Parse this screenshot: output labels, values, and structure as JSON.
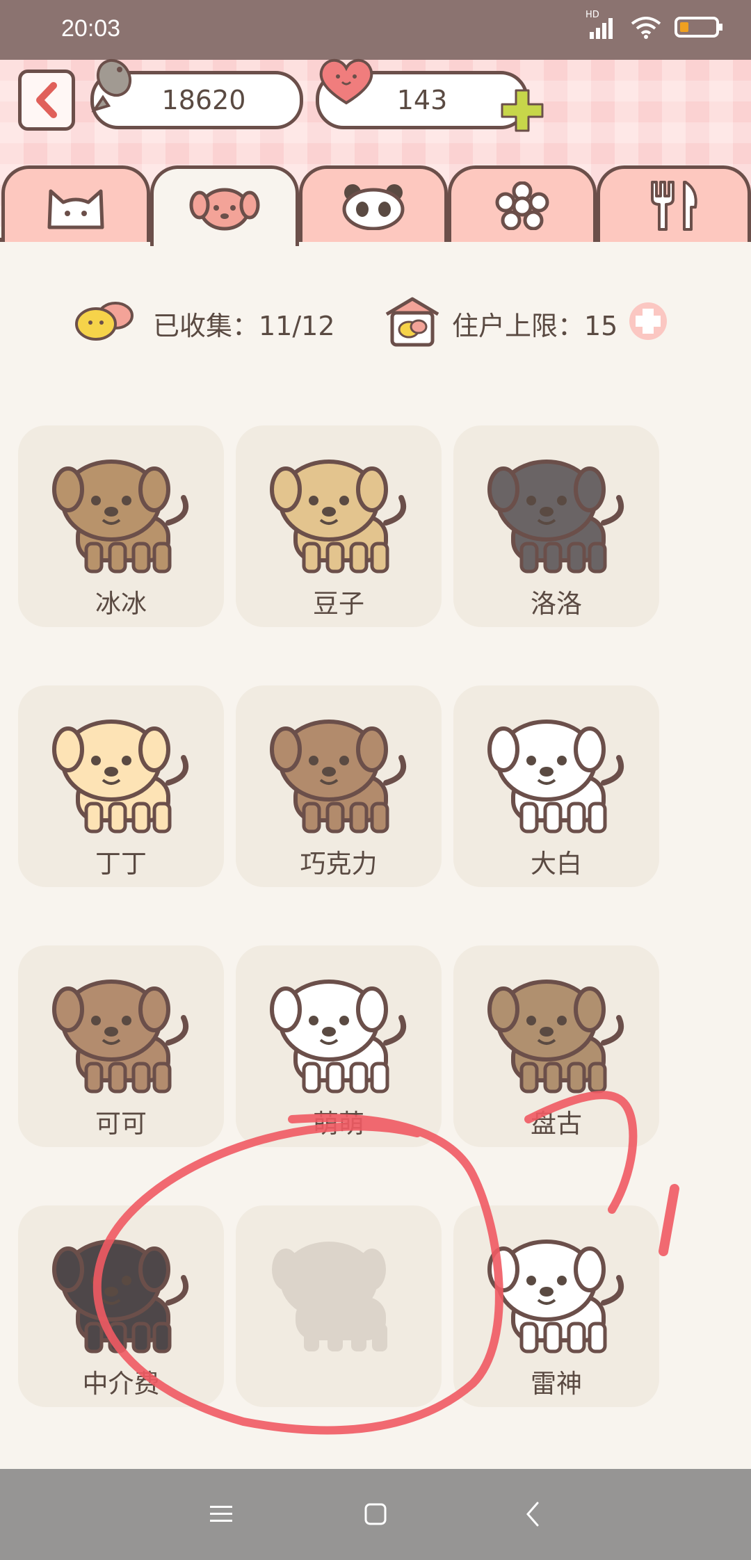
{
  "status": {
    "time": "20:03",
    "network": "HD"
  },
  "header": {
    "fish_count": "18620",
    "heart_count": "143"
  },
  "tabs": [
    {
      "name": "cat",
      "active": false
    },
    {
      "name": "dog",
      "active": true
    },
    {
      "name": "panda",
      "active": false
    },
    {
      "name": "flower",
      "active": false
    },
    {
      "name": "utensils",
      "active": false
    }
  ],
  "stats": {
    "collected_label": "已收集：11/12",
    "capacity_label": "住户上限：15"
  },
  "pets": [
    {
      "name": "冰冰",
      "color": "#b8936b"
    },
    {
      "name": "豆子",
      "color": "#e3c48e"
    },
    {
      "name": "洛洛",
      "color": "#6a6465"
    },
    {
      "name": "丁丁",
      "color": "#fde3b5"
    },
    {
      "name": "巧克力",
      "color": "#b28b6c"
    },
    {
      "name": "大白",
      "color": "#ffffff"
    },
    {
      "name": "可可",
      "color": "#b38c6e"
    },
    {
      "name": "萌萌",
      "color": "#ffffff"
    },
    {
      "name": "盘古",
      "color": "#b0906f"
    },
    {
      "name": "中介费",
      "color": "#4e4749"
    },
    {
      "name": "",
      "color": "#dcd4ca"
    },
    {
      "name": "雷神",
      "color": "#ffffff"
    }
  ],
  "colors": {
    "outline": "#6b4f4a",
    "accent_pink": "#fdc8bf",
    "plus_green": "#c7d64a",
    "scribble": "#f05a63"
  }
}
